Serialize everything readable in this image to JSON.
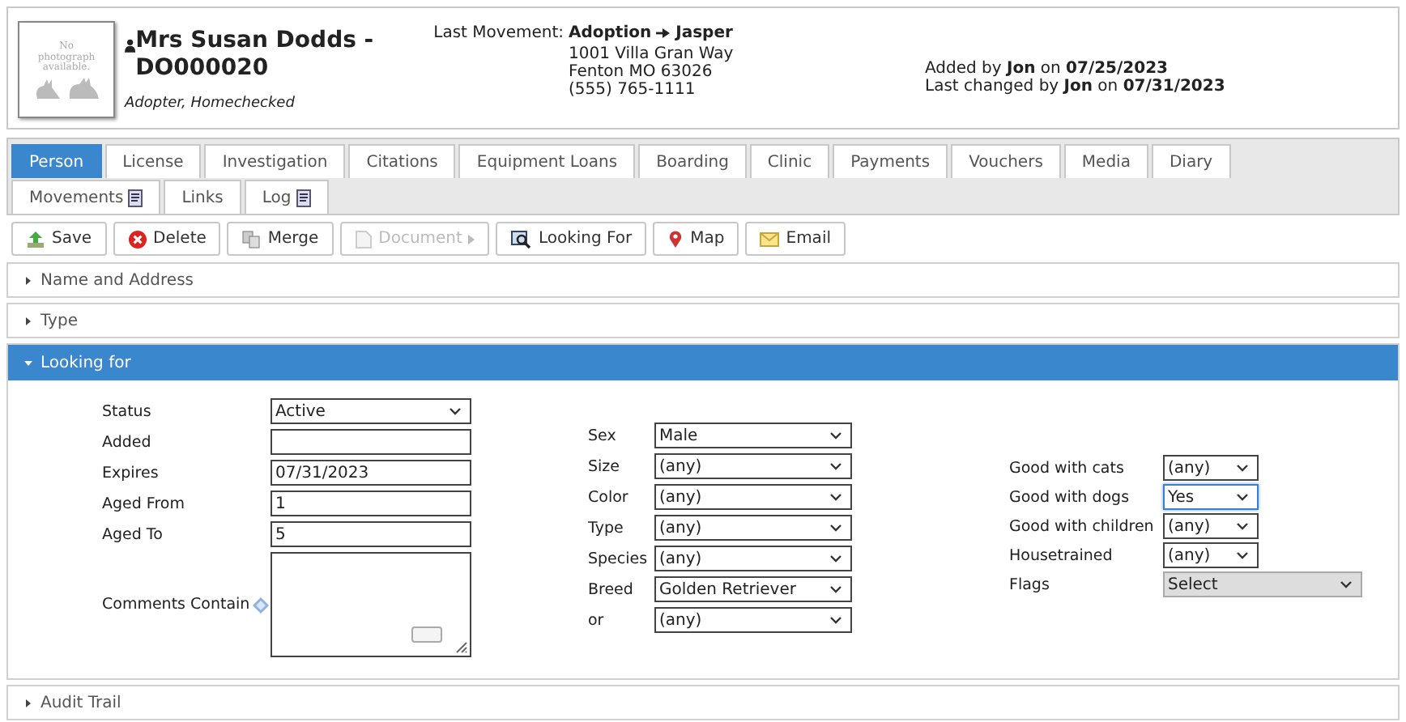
{
  "header": {
    "photo_text": "No photograph available.",
    "name": "Mrs Susan Dodds - DO000020",
    "subtitle": "Adopter, Homechecked",
    "movement_label": "Last Movement:",
    "movement_type": "Adoption",
    "movement_animal": "Jasper",
    "address": [
      "1001 Villa Gran Way",
      "Fenton MO 63026",
      "(555) 765-1111"
    ],
    "added": "Added by **Jon** on **07/25/2023**",
    "changed": "Last changed by **Jon** on **07/31/2023**"
  },
  "tabs": [
    [
      {
        "label": "Person",
        "selected": true
      },
      {
        "label": "License",
        "selected": false
      },
      {
        "label": "Investigation",
        "selected": false
      },
      {
        "label": "Citations",
        "selected": false
      },
      {
        "label": "Equipment Loans",
        "selected": false
      },
      {
        "label": "Boarding",
        "selected": false
      },
      {
        "label": "Clinic",
        "selected": false
      },
      {
        "label": "Payments",
        "selected": false
      },
      {
        "label": "Vouchers",
        "selected": false
      },
      {
        "label": "Media",
        "selected": false
      },
      {
        "label": "Diary",
        "selected": false
      }
    ],
    [
      {
        "label": "Movements",
        "selected": false
      },
      {
        "label": "Links",
        "selected": false
      },
      {
        "label": "Log",
        "selected": false
      }
    ]
  ],
  "toolbar": [
    {
      "label": "Save",
      "disabled": false
    },
    {
      "label": "Delete",
      "disabled": false
    },
    {
      "label": "Merge",
      "disabled": false
    },
    {
      "label": "Document",
      "disabled": true
    },
    {
      "label": "Looking For",
      "disabled": false
    },
    {
      "label": "Map",
      "disabled": false
    },
    {
      "label": "Email",
      "disabled": false
    }
  ],
  "sections": [
    {
      "title": "Name and Address",
      "expanded": false
    },
    {
      "title": "Type",
      "expanded": false
    },
    {
      "title": "Looking for",
      "expanded": true
    },
    {
      "title": "Audit Trail",
      "expanded": false
    }
  ],
  "form": {
    "column_1": [
      {
        "label": "Status",
        "kind": "select",
        "value": "Active"
      },
      {
        "label": "Added",
        "kind": "text"
      },
      {
        "label": "Expires",
        "kind": "text",
        "value": "07/31/2023"
      },
      {
        "label": "Aged From",
        "kind": "text",
        "value": "1"
      },
      {
        "label": "Aged To",
        "kind": "text",
        "value": "5"
      },
      {
        "label": "Comments Contain",
        "kind": "textarea"
      }
    ],
    "column_2": [
      {
        "label": "Sex",
        "kind": "select",
        "value": "Male"
      },
      {
        "label": "Size",
        "kind": "select",
        "value": "(any)"
      },
      {
        "label": "Color",
        "kind": "select",
        "value": "(any)"
      },
      {
        "label": "Type",
        "kind": "select",
        "value": "(any)"
      },
      {
        "label": "Species",
        "kind": "select",
        "value": "(any)"
      },
      {
        "label": "Breed",
        "kind": "select",
        "value": "Golden Retriever"
      },
      {
        "label": "or",
        "kind": "select",
        "value": "(any)"
      }
    ],
    "column_3": [
      {
        "label": "Good with cats",
        "kind": "select",
        "value": "(any)",
        "focused": false
      },
      {
        "label": "Good with dogs",
        "kind": "select",
        "value": "Yes",
        "focused": true
      },
      {
        "label": "Good with children",
        "kind": "select",
        "value": "(any)",
        "focused": false
      },
      {
        "label": "Housetrained",
        "kind": "select",
        "value": "(any)",
        "focused": false
      },
      {
        "label": "Flags",
        "kind": "multiselect",
        "value": "Select",
        "focused": false
      }
    ]
  }
}
